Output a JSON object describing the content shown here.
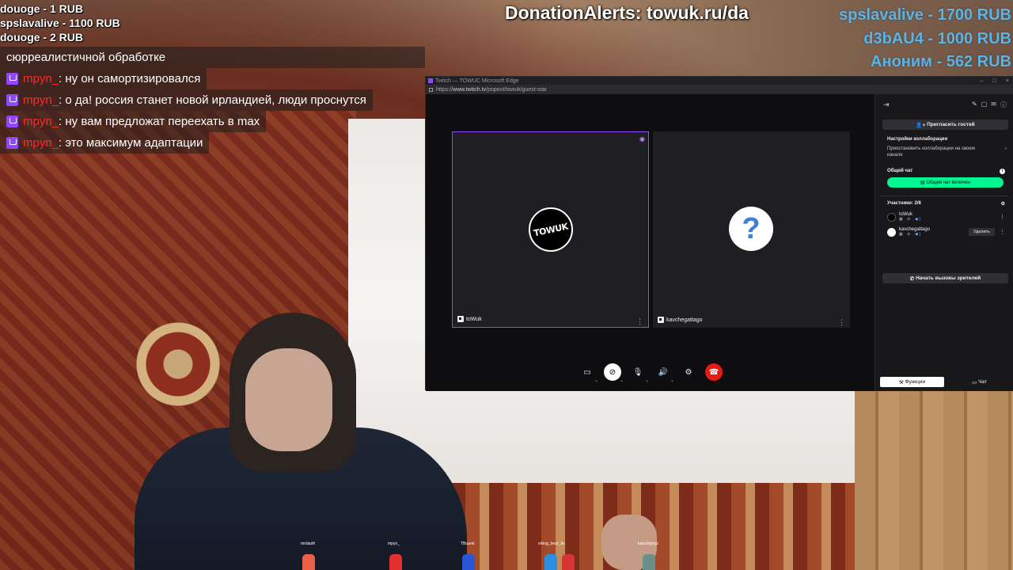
{
  "donations_recent": [
    "douoge - 1 RUB",
    "spslavalive - 1100 RUB",
    "douoge - 2 RUB"
  ],
  "donation_alerts_text": "DonationAlerts: towuk.ru/da",
  "top_donors": [
    "spslavalive - 1700 RUB",
    "d3bAU4 - 1000 RUB",
    "Аноним - 562 RUB"
  ],
  "chat": {
    "first_line": "сюрреалистичной обработке",
    "messages": [
      {
        "user": "mpyn_",
        "text": ": ну он самортизировался"
      },
      {
        "user": "mpyn_",
        "text": ": о да! россия станет новой ирландией, люди проснутся"
      },
      {
        "user": "mpyn_",
        "text": ": ну вам предложат переехать в max"
      },
      {
        "user": "mpyn_",
        "text": ": это максимум адаптации"
      }
    ]
  },
  "browser": {
    "title": "Twitch — TOWUC Microsoft Edge",
    "url_prefix": "https://",
    "url_host": "www.twitch.tv",
    "url_path": "/popout/towuk/guest-star"
  },
  "tiles": [
    {
      "name": "toWuk",
      "avatar_text": "TOWUK",
      "active": true
    },
    {
      "name": "kavchegattago",
      "avatar_text": "?",
      "active": false
    }
  ],
  "panel": {
    "invite_label": "Пригласить гостей",
    "collab_settings_title": "Настройки коллаборации",
    "collab_pause_text": "Приостановить коллаборации на своем канале",
    "shared_chat_title": "Общий чат",
    "shared_chat_enabled": "Общий чат включен",
    "participants_label": "Участники: 2/6",
    "participants": [
      {
        "name": "toWuk",
        "remove": ""
      },
      {
        "name": "kavchegattago",
        "remove": "Удалить"
      }
    ],
    "viewer_calls_label": "Начать вызовы зрителей",
    "tab_functions": "Функции",
    "tab_chat": "Чат"
  },
  "colors": {
    "twitch_purple": "#9146ff",
    "shared_chat_green": "#00f593",
    "hangup_red": "#e91916",
    "chat_username": "#ff2a2a",
    "top_donor_blue": "#5ab4e8"
  },
  "sprites": [
    {
      "label": "mrdauth",
      "color": "#e8604a"
    },
    {
      "label": "mpyn_",
      "color": "#e23030"
    },
    {
      "label": "TBuarel",
      "color": "#2b57d6"
    },
    {
      "label": "viking_bear_ttv",
      "color": "#2c8ee0"
    },
    {
      "label": "",
      "color": "#d93434"
    },
    {
      "label": "kaloshqmyc",
      "color": "#6d8f8a"
    }
  ]
}
